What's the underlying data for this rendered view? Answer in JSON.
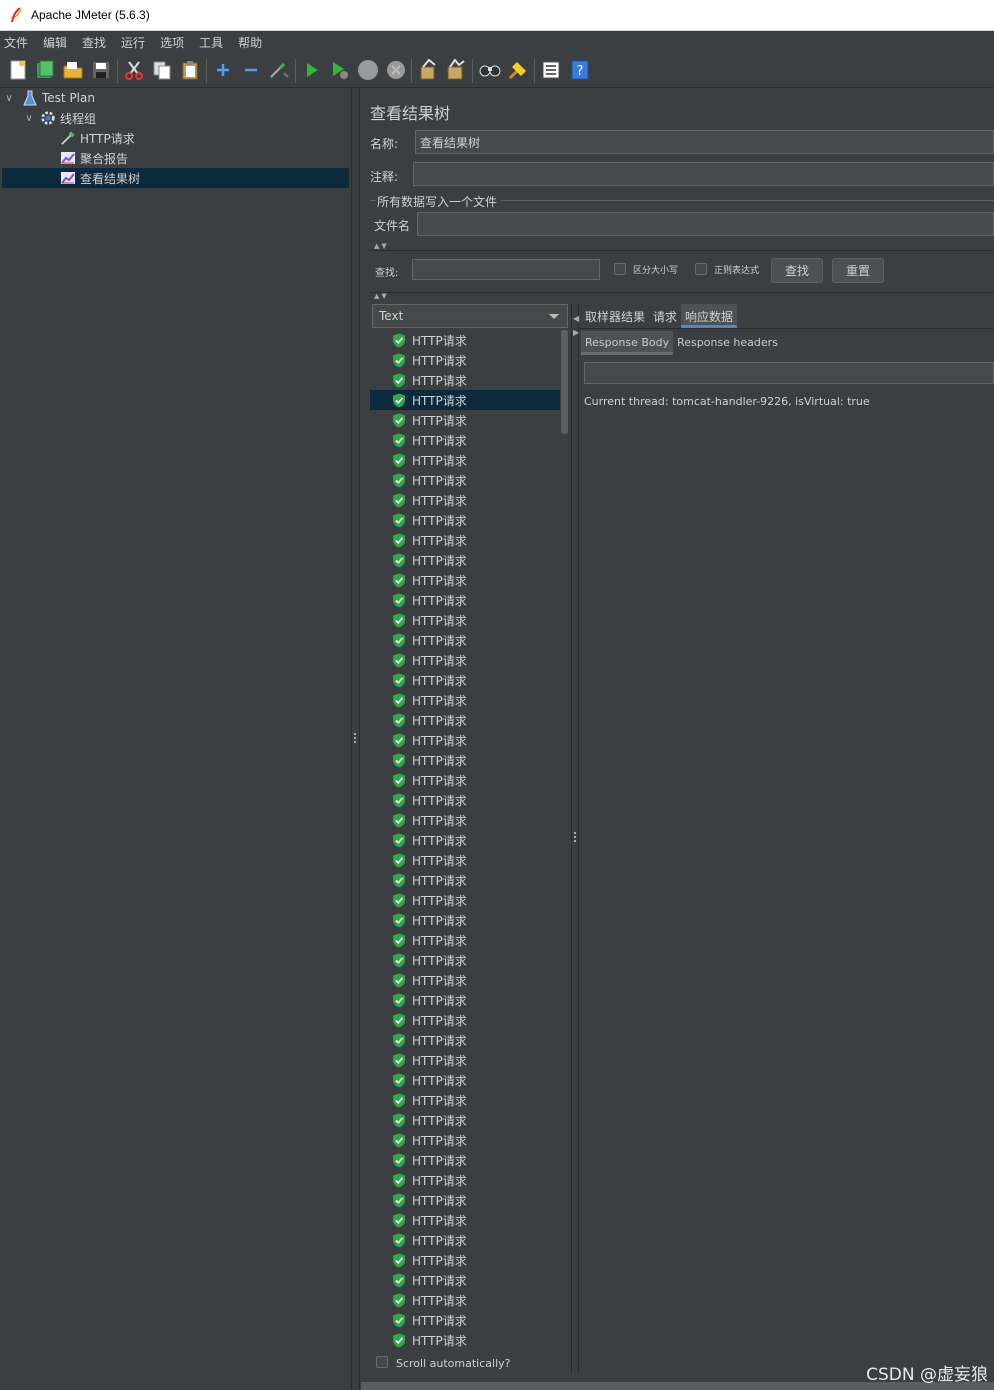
{
  "window": {
    "title": "Apache JMeter (5.6.3)"
  },
  "menu": [
    "文件",
    "编辑",
    "查找",
    "运行",
    "选项",
    "工具",
    "帮助"
  ],
  "toolbar_icons": [
    "new-icon",
    "templates-icon",
    "open-icon",
    "save-icon",
    "cut-icon",
    "copy-icon",
    "paste-icon",
    "expand-icon",
    "collapse-icon",
    "toggle-icon",
    "start-icon",
    "start-no-pause-icon",
    "stop-icon",
    "shutdown-icon",
    "clear-icon",
    "clear-all-icon",
    "search-icon",
    "reset-search-icon",
    "function-helper-icon",
    "help-icon"
  ],
  "tree": {
    "items": [
      {
        "label": "Test Plan",
        "icon": "flask-icon"
      },
      {
        "label": "线程组",
        "icon": "gear-icon"
      },
      {
        "label": "HTTP请求",
        "icon": "pipette-icon"
      },
      {
        "label": "聚合报告",
        "icon": "chart-icon"
      },
      {
        "label": "查看结果树",
        "icon": "chart-icon"
      }
    ]
  },
  "panel": {
    "title": "查看结果树",
    "name_label": "名称:",
    "name_value": "查看结果树",
    "comment_label": "注释:",
    "comment_value": "",
    "group_title": "所有数据写入一个文件",
    "filename_label": "文件名",
    "filename_value": "",
    "search_label": "查找:",
    "search_value": "",
    "case_label": "区分大小写",
    "regex_label": "正则表达式",
    "find_button": "查找",
    "reset_button": "重置",
    "renderer": "Text",
    "scroll_auto": "Scroll automatically?"
  },
  "results": {
    "sample_label": "HTTP请求",
    "count": 51,
    "selected_index": 3
  },
  "tabs": [
    "取样器结果",
    "请求",
    "响应数据"
  ],
  "active_tab": 2,
  "subtabs": [
    "Response Body",
    "Response headers"
  ],
  "active_subtab": 0,
  "response": {
    "search_value": "",
    "body_text": "Current thread: tomcat-handler-9226, isVirtual: true"
  },
  "watermark": "CSDN @虚妄狼"
}
